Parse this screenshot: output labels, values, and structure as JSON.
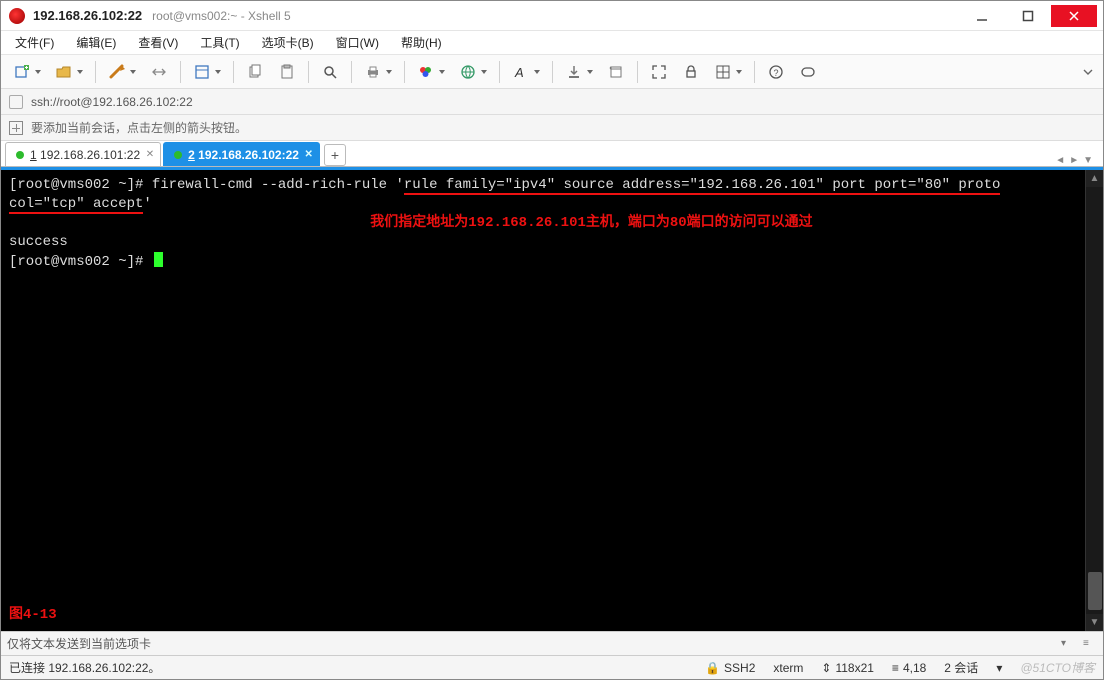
{
  "window": {
    "title_main": "192.168.26.102:22",
    "title_sub": "root@vms002:~ - Xshell 5"
  },
  "menu": {
    "file": "文件(F)",
    "edit": "编辑(E)",
    "view": "查看(V)",
    "tools": "工具(T)",
    "options": "选项卡(B)",
    "window": "窗口(W)",
    "help": "帮助(H)"
  },
  "address": "ssh://root@192.168.26.102:22",
  "hint": "要添加当前会话，点击左侧的箭头按钮。",
  "tabs": [
    {
      "num": "1",
      "label": "192.168.26.101:22",
      "active": false
    },
    {
      "num": "2",
      "label": "192.168.26.102:22",
      "active": true
    }
  ],
  "terminal": {
    "prompt1_a": "[root@vms002 ~]# ",
    "cmd_plain": "firewall-cmd --add-rich-rule '",
    "cmd_rule_line1": "rule family=\"ipv4\" source address=\"192.168.26.101\" port port=\"80\" proto",
    "cmd_rule_line2": "col=\"tcp\" accept",
    "cmd_trailquote": "'",
    "annotation": "我们指定地址为192.168.26.101主机，端口为80端口的访问可以通过",
    "out1": "success",
    "prompt2": "[root@vms002 ~]# ",
    "caption": "图4-13"
  },
  "inputbar": {
    "placeholder": "仅将文本发送到当前选项卡"
  },
  "status": {
    "conn": "已连接 192.168.26.102:22。",
    "ssh": "SSH2",
    "termtype": "xterm",
    "size": "118x21",
    "pos": "4,18",
    "sessions": "2 会话",
    "watermark": "@51CTO博客"
  },
  "icons": {
    "lock": "🔒",
    "sizearrow": "⇕",
    "caret": "▾"
  }
}
